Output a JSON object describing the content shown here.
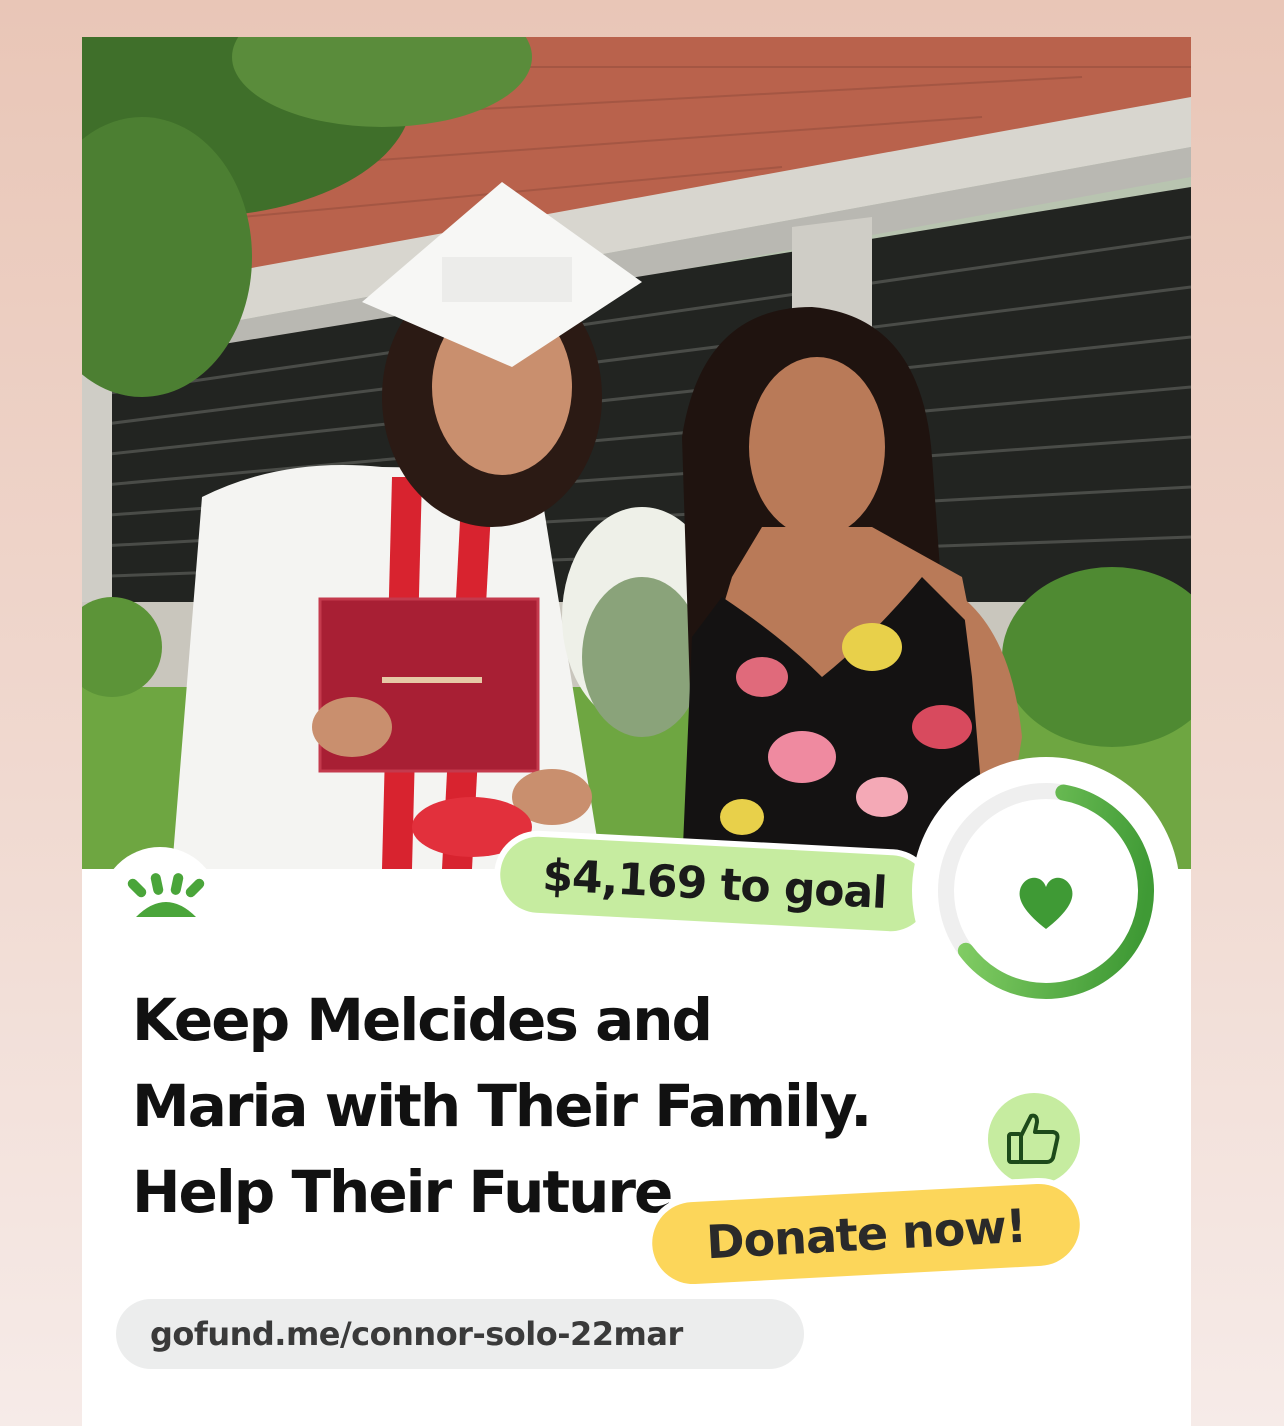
{
  "campaign": {
    "goal_remaining": "$4,169 to goal",
    "title": "Keep Melcides and Maria with Their Family. Help Their Future",
    "cta": "Donate now!",
    "url": "gofund.me/connor-solo-22mar",
    "progress_fraction": 0.62
  },
  "icons": {
    "logo": "gofundme-sunrise-logo",
    "progress": "heart-icon",
    "like": "thumbs-up-icon"
  },
  "colors": {
    "brand_green": "#4aa53a",
    "light_green": "#c6eca0",
    "cta_yellow": "#fcd65a"
  }
}
